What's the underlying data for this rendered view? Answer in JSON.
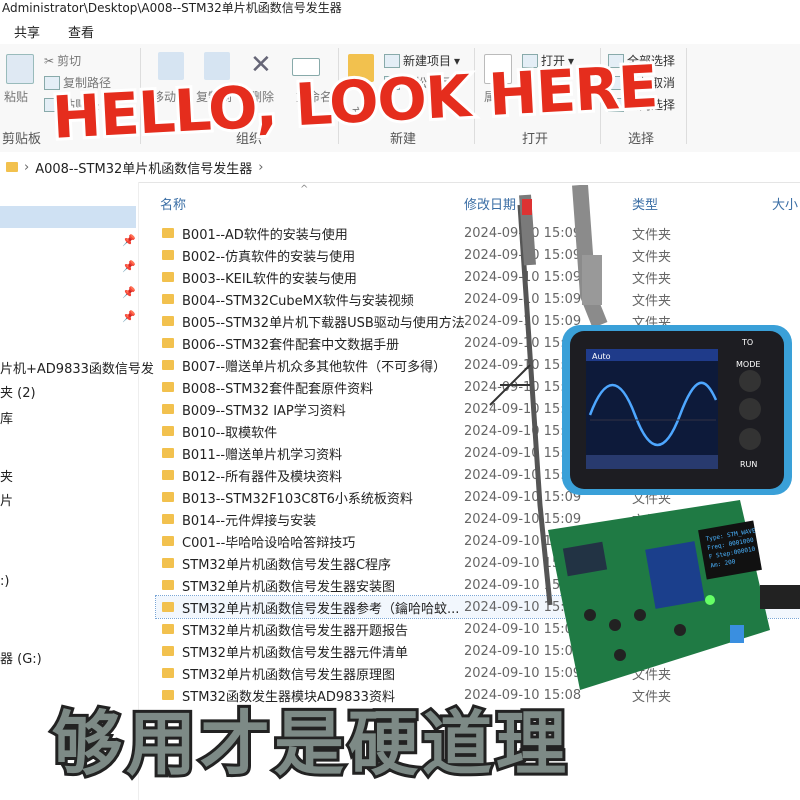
{
  "window": {
    "path": "Administrator\\Desktop\\A008--STM32单片机函数信号发生器"
  },
  "menu": {
    "tabs": [
      "共享",
      "查看"
    ]
  },
  "ribbon": {
    "clipboard": {
      "paste": "粘贴",
      "cut": "剪切",
      "copy_path": "复制路径",
      "paste_shortcut": "粘贴快",
      "group": "剪贴板"
    },
    "organize": {
      "move_to": "移动到",
      "copy_to": "复制到",
      "delete": "删除",
      "rename": "重命名",
      "group": "组织"
    },
    "new": {
      "new_folder": "文",
      "new_item": "新建项目",
      "easy_access": "轻松访问",
      "group": "新建"
    },
    "open": {
      "properties": "属性",
      "open": "打开",
      "group": "打开"
    },
    "select": {
      "select_all": "全部选择",
      "select_none": "全部取消",
      "invert": "反向选择",
      "group": "选择"
    }
  },
  "address": {
    "crumb": "A008--STM32单片机函数信号发生器"
  },
  "columns": {
    "name": "名称",
    "date": "修改日期",
    "type": "类型",
    "size": "大小"
  },
  "sidebar": {
    "items": [
      "片机+AD9833函数信号发",
      "夹 (2)",
      "库",
      "夹",
      "片",
      ":)",
      "器 (G:)"
    ]
  },
  "files": [
    {
      "name": "B001--AD软件的安装与使用",
      "date": "2024-09-10 15:09",
      "type": "文件夹",
      "kind": "folder"
    },
    {
      "name": "B002--仿真软件的安装与使用",
      "date": "2024-09-10 15:09",
      "type": "文件夹",
      "kind": "folder"
    },
    {
      "name": "B003--KEIL软件的安装与使用",
      "date": "2024-09-10 15:09",
      "type": "文件夹",
      "kind": "folder"
    },
    {
      "name": "B004--STM32CubeMX软件与安装视频",
      "date": "2024-09-10 15:09",
      "type": "文件夹",
      "kind": "folder"
    },
    {
      "name": "B005--STM32单片机下载器USB驱动与使用方法",
      "date": "2024-09-10 15:09",
      "type": "文件夹",
      "kind": "folder"
    },
    {
      "name": "B006--STM32套件配套中文数据手册",
      "date": "2024-09-10 15:09",
      "type": "文件夹",
      "kind": "folder"
    },
    {
      "name": "B007--赠送单片机众多其他软件（不可多得）",
      "date": "2024-09-10 15:09",
      "type": "文件夹",
      "kind": "folder"
    },
    {
      "name": "B008--STM32套件配套原件资料",
      "date": "2024-09-10 15:09",
      "type": "文件夹",
      "kind": "folder"
    },
    {
      "name": "B009--STM32 IAP学习资料",
      "date": "2024-09-10 15:09",
      "type": "文件夹",
      "kind": "folder"
    },
    {
      "name": "B010--取模软件",
      "date": "2024-09-10 15:09",
      "type": "文件夹",
      "kind": "folder"
    },
    {
      "name": "B011--赠送单片机学习资料",
      "date": "2024-09-10 15:09",
      "type": "文件夹",
      "kind": "folder"
    },
    {
      "name": "B012--所有器件及模块资料",
      "date": "2024-09-10 15:09",
      "type": "文件夹",
      "kind": "folder"
    },
    {
      "name": "B013--STM32F103C8T6小系统板资料",
      "date": "2024-09-10 15:09",
      "type": "文件夹",
      "kind": "folder"
    },
    {
      "name": "B014--元件焊接与安装",
      "date": "2024-09-10 15:09",
      "type": "文件夹",
      "kind": "folder"
    },
    {
      "name": "C001--毕哈哈设哈哈答辩技巧",
      "date": "2024-09-10 15:09",
      "type": "文件夹",
      "kind": "folder"
    },
    {
      "name": "STM32单片机函数信号发生器C程序",
      "date": "2024-09-10 15:09",
      "type": "文件夹",
      "kind": "folder"
    },
    {
      "name": "STM32单片机函数信号发生器安装图",
      "date": "2024-09-10 15:09",
      "type": "文件夹",
      "kind": "folder"
    },
    {
      "name": "STM32单片机函数信号发生器参考（鑰哈哈蚊...",
      "date": "2024-09-10 15:09",
      "type": "文件夹",
      "kind": "folder",
      "highlight": true
    },
    {
      "name": "STM32单片机函数信号发生器开题报告",
      "date": "2024-09-10 15:09",
      "type": "文件夹",
      "kind": "folder"
    },
    {
      "name": "STM32单片机函数信号发生器元件清单",
      "date": "2024-09-10 15:09",
      "type": "文件夹",
      "kind": "folder"
    },
    {
      "name": "STM32单片机函数信号发生器原理图",
      "date": "2024-09-10 15:09",
      "type": "文件夹",
      "kind": "folder"
    },
    {
      "name": "STM32函数发生器模块AD9833资料",
      "date": "2024-09-10 15:08",
      "type": "文件夹",
      "kind": "folder"
    }
  ],
  "overlay": {
    "hello": "HELLO, LOOK HERE",
    "slogan": "够用才是硬道理"
  },
  "device": {
    "scope_buttons": [
      "TO",
      "MODE",
      "RUN"
    ],
    "scope_mode": "Auto",
    "oled_lines": [
      "Type: STM_WAVE",
      "Freq: 0001000",
      "F Step:000010",
      "Am: 200"
    ]
  },
  "colors": {
    "accent": "#3a6ea5",
    "folder": "#f2c14e",
    "hello": "#e52d1d",
    "slogan": "#7d8a86",
    "selection": "#cfe1f3"
  }
}
